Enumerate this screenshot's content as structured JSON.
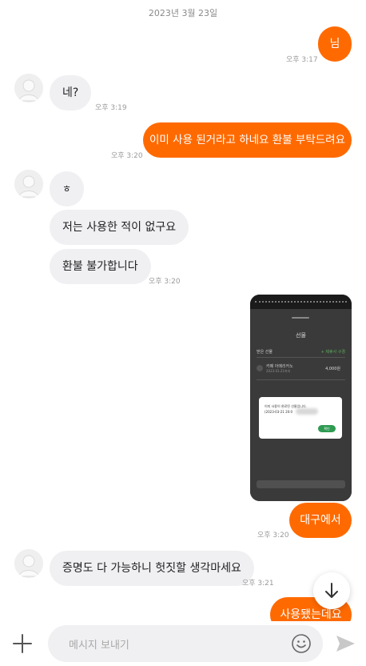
{
  "date_divider": "2023년 3월 23일",
  "messages": [
    {
      "text": "님",
      "time": "오후 3:17"
    },
    {
      "text": "네?",
      "time": "오후 3:19"
    },
    {
      "text": "이미 사용 된거라고 하네요 환불 부탁드려요",
      "time": "오후 3:20"
    },
    {
      "text": "ㅎ"
    },
    {
      "text": "저는 사용한 적이 없구요"
    },
    {
      "text": "환불 불가합니다",
      "time": "오후 3:20"
    },
    {
      "text": "대구에서",
      "time": "오후 3:20"
    },
    {
      "text": "증명도 다 가능하니 헛짓할 생각마세요",
      "time": "오후 3:21"
    },
    {
      "text": "사용됐는데요"
    }
  ],
  "screenshot": {
    "title": "선물",
    "section_label": "받은 선물",
    "section_action": "+ 제휴사 구경",
    "item_name": "카페 아메리카노",
    "item_sub": "2023.03.21까지",
    "item_price": "4,000원",
    "dialog_line1": "이미 사용이 완료된 선물입니다.",
    "dialog_line2": "(2023-03-21 20:0",
    "dialog_ok": "확인"
  },
  "input": {
    "placeholder": "메시지 보내기"
  },
  "icons": {
    "scroll": "arrow-down-icon",
    "attach": "plus-icon",
    "emoji": "smiley-icon",
    "send": "send-icon"
  },
  "colors": {
    "outgoing_bubble": "#ff6a00",
    "incoming_bubble": "#f0f0f3",
    "time": "#9a9a9a"
  }
}
